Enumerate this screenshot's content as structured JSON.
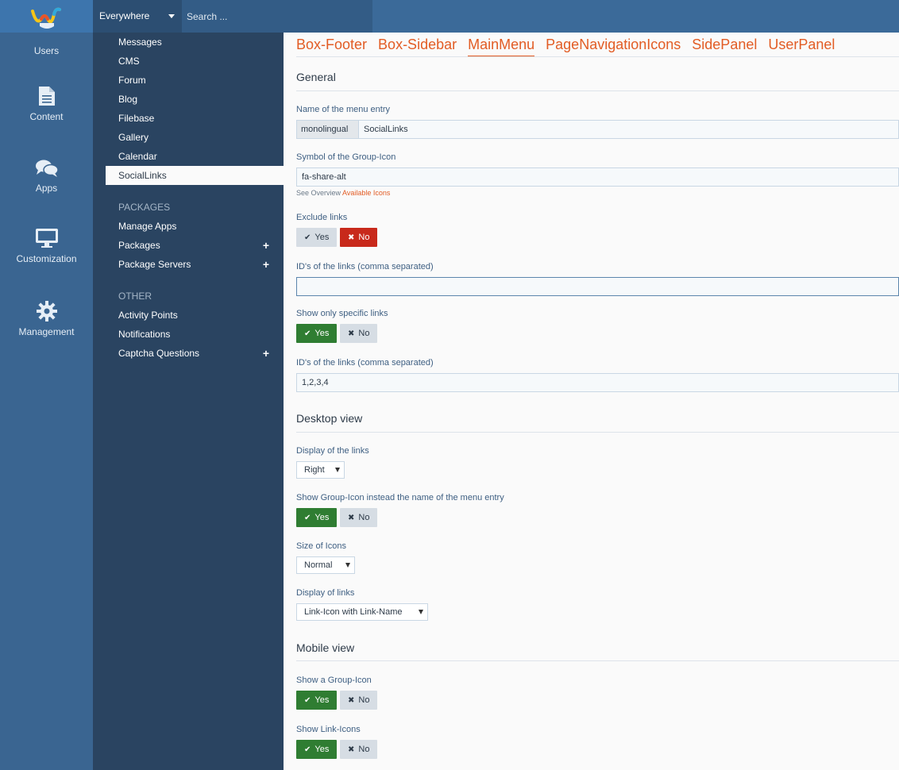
{
  "header": {
    "search_scope": "Everywhere",
    "search_placeholder": "Search ..."
  },
  "icon_nav": [
    {
      "label": "Users",
      "icon": "users-icon"
    },
    {
      "label": "Content",
      "icon": "document-icon"
    },
    {
      "label": "Apps",
      "icon": "comments-icon"
    },
    {
      "label": "Customization",
      "icon": "desktop-icon"
    },
    {
      "label": "Management",
      "icon": "gear-icon"
    }
  ],
  "submenu": {
    "items": [
      "Messages",
      "CMS",
      "Forum",
      "Blog",
      "Filebase",
      "Gallery",
      "Calendar",
      "SocialLinks"
    ],
    "packages_heading": "PACKAGES",
    "packages": [
      "Manage Apps",
      "Packages",
      "Package Servers"
    ],
    "other_heading": "OTHER",
    "other": [
      "Activity Points",
      "Notifications",
      "Captcha Questions"
    ],
    "plus": "+"
  },
  "tabs": [
    "Box-Footer",
    "Box-Sidebar",
    "MainMenu",
    "PageNavigationIcons",
    "SidePanel",
    "UserPanel"
  ],
  "general": {
    "title": "General",
    "menu_name_label": "Name of the menu entry",
    "menu_name_addon": "monolingual",
    "menu_name_value": "SocialLinks",
    "group_icon_label": "Symbol of the Group-Icon",
    "group_icon_value": "fa-share-alt",
    "hint_prefix": "See Overview",
    "hint_link": "Available Icons",
    "exclude_label": "Exclude links",
    "exclude_ids_label": "ID's of the links (comma separated)",
    "exclude_ids_value": "",
    "specific_label": "Show only specific links",
    "specific_ids_label": "ID's of the links (comma separated)",
    "specific_ids_value": "1,2,3,4"
  },
  "desktop": {
    "title": "Desktop view",
    "display_links_label": "Display of the links",
    "display_links_value": "Right",
    "show_group_icon_label": "Show Group-Icon instead the name of the menu entry",
    "size_icons_label": "Size of Icons",
    "size_icons_value": "Normal",
    "display_of_links_label": "Display of links",
    "display_of_links_value": "Link-Icon with Link-Name"
  },
  "mobile": {
    "title": "Mobile view",
    "show_group_icon_label": "Show a Group-Icon",
    "show_link_icons_label": "Show Link-Icons"
  },
  "buttons": {
    "yes": "Yes",
    "no": "No",
    "check_icon": "✔",
    "x_icon": "✖"
  },
  "colors": {
    "accent": "#e25c24",
    "yes_active": "#2f7d32",
    "no_active": "#c8291b",
    "sidebar": "#3a6591",
    "submenu": "#2a4461"
  }
}
